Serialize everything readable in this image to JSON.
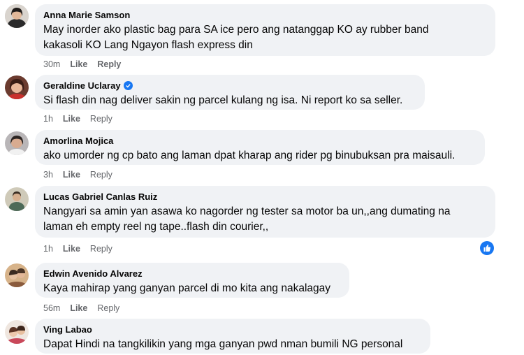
{
  "comments": [
    {
      "author": "Anna Marie Samson",
      "text_lines": [
        "May inorder ako plastic bag para SA ice pero ang natanggap KO ay rubber band",
        "kakasoli KO Lang Ngayon flash express din"
      ],
      "time": "30m",
      "like": "Like",
      "reply": "Reply"
    },
    {
      "author": "Geraldine Uclaray",
      "verified": true,
      "text_lines": [
        "Si flash din nag deliver sakin ng parcel kulang ng isa. Ni report ko sa seller."
      ],
      "time": "1h",
      "like": "Like",
      "reply": "Reply"
    },
    {
      "author": "Amorlina Mojica",
      "text_lines": [
        "ako umorder ng cp bato ang laman dpat kharap ang rider pg binubuksan pra maisauli."
      ],
      "time": "3h",
      "like": "Like",
      "reply": "Reply"
    },
    {
      "author": "Lucas Gabriel Canlas Ruiz",
      "text_lines": [
        "Nangyari sa amin yan asawa ko nagorder ng tester sa motor ba un,,ang dumating na",
        "laman eh empty reel ng tape..flash din courier,,"
      ],
      "time": "1h",
      "like": "Like",
      "reply": "Reply",
      "reaction": "like"
    },
    {
      "author": "Edwin Avenido Alvarez",
      "text_lines": [
        "Kaya mahirap yang ganyan parcel di mo kita ang nakalagay"
      ],
      "time": "56m",
      "like": "Like",
      "reply": "Reply"
    },
    {
      "author": "Ving Labao",
      "text_lines": [
        "Dapat Hindi na tangkilikin yang mga ganyan pwd nman bumili NG personal"
      ],
      "time": "",
      "like": "",
      "reply": ""
    }
  ],
  "colors": {
    "bubble": "#f0f2f5",
    "meta": "#65676b",
    "accent": "#1877f2"
  }
}
